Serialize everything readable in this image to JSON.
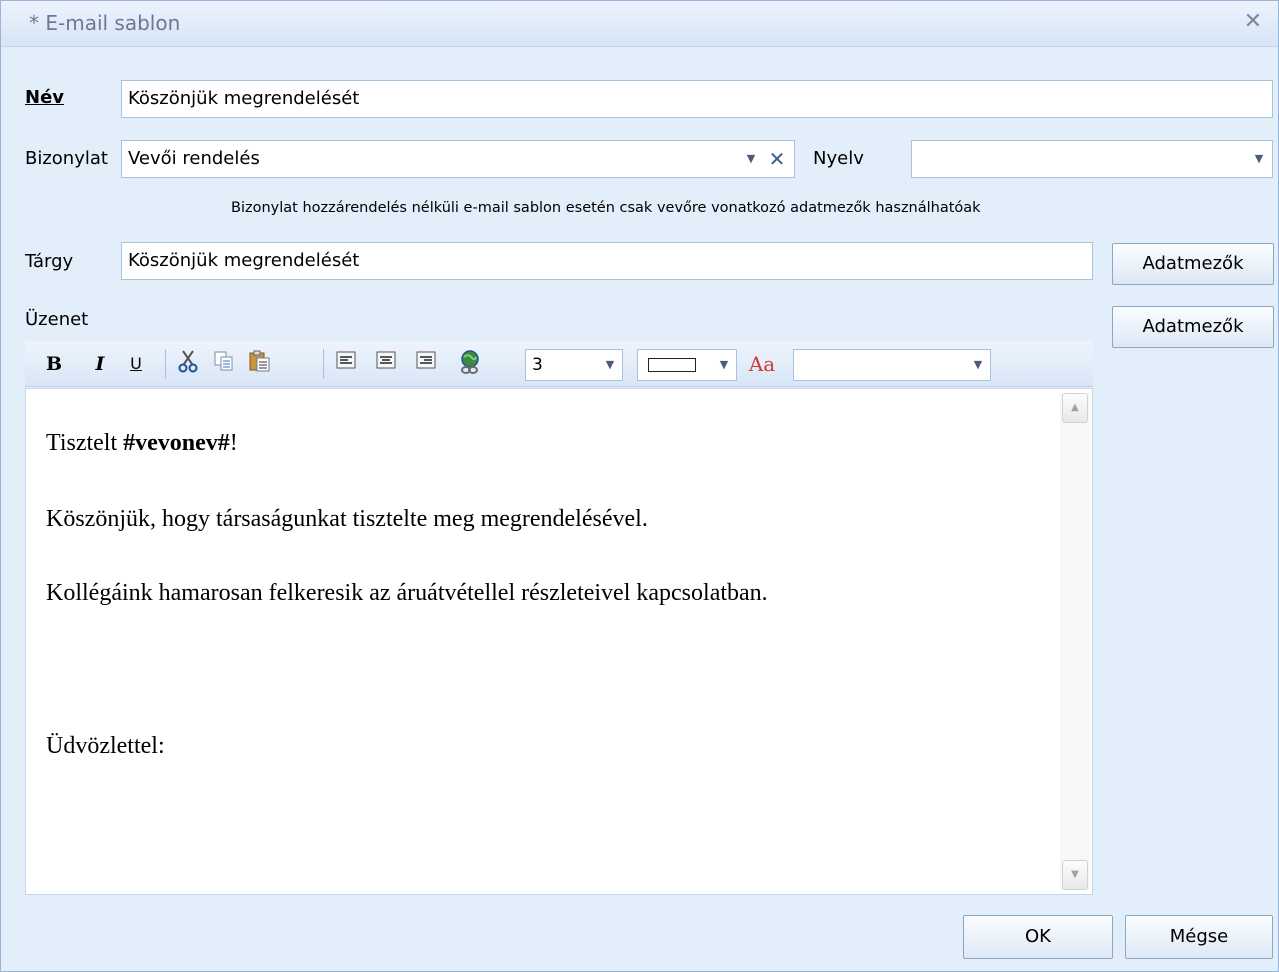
{
  "window": {
    "title": "* E-mail sablon",
    "close_glyph": "✕"
  },
  "fields": {
    "nev": {
      "label": "Név",
      "value": "Köszönjük megrendelését"
    },
    "bizonylat": {
      "label": "Bizonylat",
      "value": "Vevői rendelés"
    },
    "nyelv": {
      "label": "Nyelv",
      "value": ""
    },
    "hint": "Bizonylat hozzárendelés nélküli e-mail sablon esetén csak vevőre vonatkozó adatmezők használhatóak",
    "targy": {
      "label": "Tárgy",
      "value": "Köszönjük megrendelését"
    },
    "uzenet": {
      "label": "Üzenet"
    }
  },
  "buttons": {
    "adatmezok_targy": "Adatmezők",
    "adatmezok_uzenet": "Adatmezők",
    "ok": "OK",
    "cancel": "Mégse"
  },
  "toolbar": {
    "bold": "B",
    "italic": "I",
    "underline": "U",
    "font_size": "3",
    "font_color_glyph": "Aa",
    "font_name": "",
    "icons": [
      "cut-icon",
      "copy-icon",
      "paste-icon",
      "align-left-icon",
      "align-center-icon",
      "align-right-icon",
      "hyperlink-icon",
      "border-box-icon",
      "font-color-icon"
    ]
  },
  "message": {
    "greeting_prefix": "Tisztelt ",
    "greeting_field": "#vevonev#",
    "greeting_suffix": "!",
    "line1": "Köszönjük, hogy társaságunkat tisztelte meg megrendelésével.",
    "line2": "Kollégáink hamarosan felkeresik az áruátvétellel részleteivel kapcsolatban.",
    "closing": "Üdvözlettel:"
  },
  "colors": {
    "background": "#e3eefb",
    "border": "#98b5d9",
    "accent": "#3b5f8e"
  }
}
